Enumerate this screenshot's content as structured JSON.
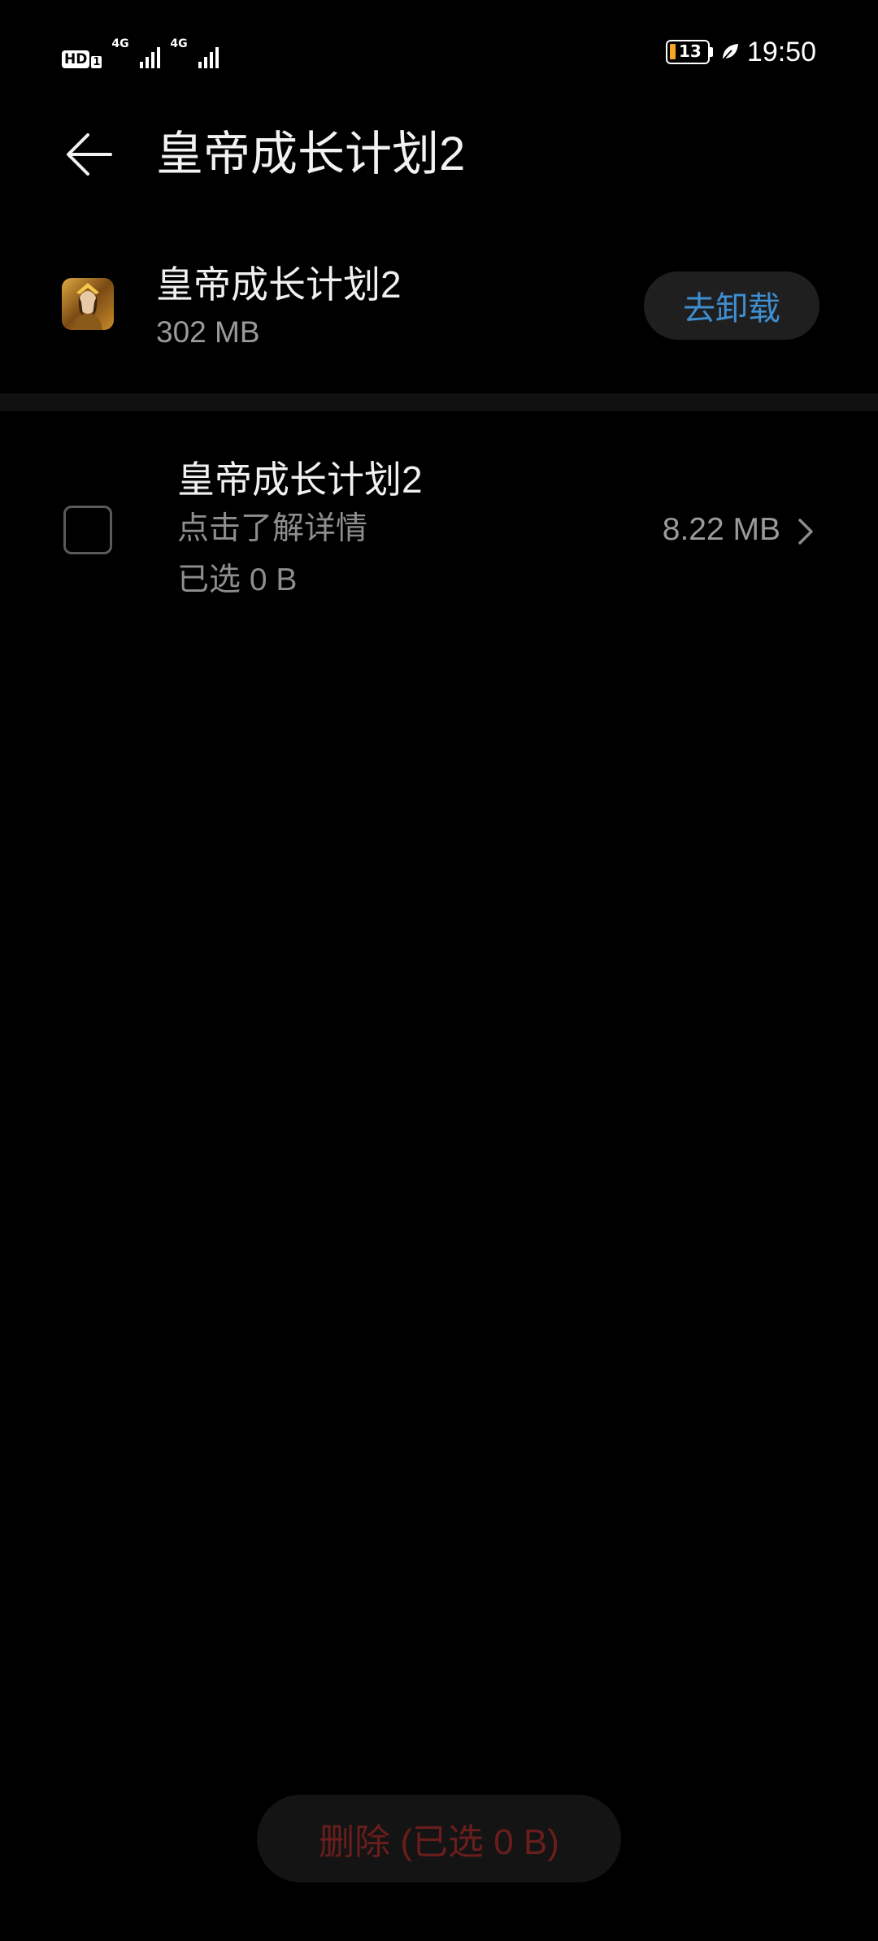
{
  "status_bar": {
    "hd_label": "HD",
    "hd_sub": "1",
    "signal_1_gen": "4G",
    "signal_2_gen": "4G",
    "battery_level": "13",
    "battery_color": "#f5a623",
    "clock": "19:50",
    "icons": [
      "hd-icon",
      "signal-icon",
      "signal-icon",
      "battery-icon",
      "power-saving-leaf-icon"
    ]
  },
  "header": {
    "back_icon": "arrow-left-icon",
    "title": "皇帝成长计划2"
  },
  "app_info": {
    "name": "皇帝成长计划2",
    "size": "302 MB",
    "uninstall_label": "去卸载",
    "accent_color": "#3e8ed0"
  },
  "cache_item": {
    "title": "皇帝成长计划2",
    "hint": "点击了解详情",
    "selected": "已选 0 B",
    "size": "8.22 MB",
    "checked": false
  },
  "footer": {
    "delete_label": "删除 (已选 0 B)",
    "delete_color": "#6a1d1d",
    "enabled": false
  }
}
